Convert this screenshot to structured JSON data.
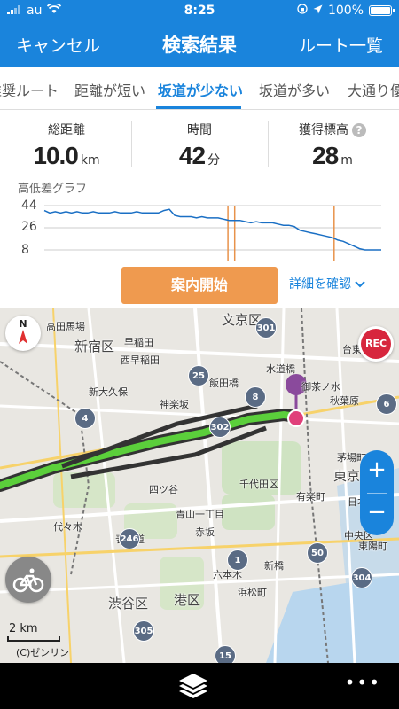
{
  "status": {
    "carrier": "au",
    "time": "8:25",
    "battery": "100%"
  },
  "nav": {
    "cancel_label": "キャンセル",
    "title": "検索結果",
    "route_list_label": "ルート一覧"
  },
  "tabs": [
    {
      "label": "推奨ルート"
    },
    {
      "label": "距離が短い"
    },
    {
      "label": "坂道が少ない"
    },
    {
      "label": "坂道が多い"
    },
    {
      "label": "大通り優"
    }
  ],
  "stats": {
    "distance": {
      "label": "総距離",
      "value": "10.0",
      "unit": "km"
    },
    "time": {
      "label": "時間",
      "value": "42",
      "unit": "分"
    },
    "elevation": {
      "label": "獲得標高",
      "value": "28",
      "unit": "m"
    }
  },
  "graph": {
    "title": "高低差グラフ",
    "y_ticks": [
      "44",
      "26",
      "8"
    ]
  },
  "chart_data": {
    "type": "line",
    "title": "高低差グラフ",
    "ylim": [
      8,
      44
    ],
    "y_ticks": [
      44,
      26,
      8
    ],
    "series": [
      {
        "values": [
          40,
          38,
          39,
          38,
          39,
          38,
          39,
          38,
          38,
          39,
          38,
          38,
          38,
          39,
          38,
          38,
          38,
          39,
          38,
          38,
          38,
          38,
          40,
          41,
          36,
          35,
          35,
          35,
          34,
          35,
          34,
          34,
          34,
          33,
          32,
          32,
          32,
          31,
          30,
          31,
          30,
          30,
          30,
          29,
          28,
          28,
          27,
          24,
          23,
          22,
          21,
          20,
          19,
          18,
          16,
          15,
          13,
          11,
          9,
          8,
          8,
          8,
          8
        ]
      }
    ],
    "markers": [
      0.545,
      0.565,
      0.86
    ]
  },
  "actions": {
    "start_label": "案内開始",
    "detail_label": "詳細を確認"
  },
  "map": {
    "labels": [
      "文京区",
      "新宿区",
      "渋谷区",
      "港区",
      "東京",
      "中央区",
      "千代田区",
      "秋葉原",
      "台東区"
    ],
    "small_labels": [
      "高田馬場",
      "早稲田",
      "新大久保",
      "西早稲田",
      "飯田橋",
      "水道橋",
      "御茶ノ水",
      "神楽坂",
      "四ツ谷",
      "赤坂",
      "新橋",
      "六本木",
      "表参道",
      "代々木",
      "青山一丁目",
      "有楽町",
      "日本橋",
      "浜松町",
      "茅場町",
      "東陽町"
    ],
    "route_shields": [
      "301",
      "25",
      "8",
      "4",
      "302",
      "6",
      "246",
      "1",
      "50",
      "304",
      "305",
      "15"
    ],
    "compass": "N",
    "rec_label": "REC",
    "scale_label": "2 km",
    "copyright": "(C)ゼンリン"
  }
}
